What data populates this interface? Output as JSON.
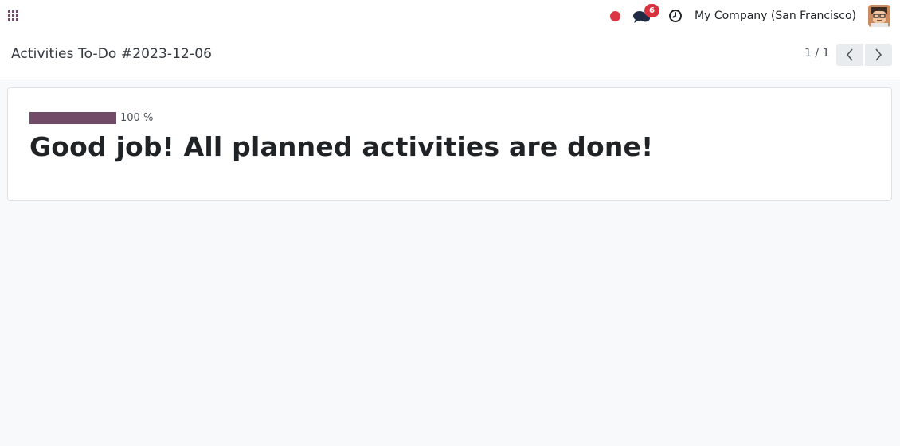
{
  "topbar": {
    "apps_icon": "grid-icon",
    "recording_indicator": "red-dot-icon",
    "messages": {
      "icon": "chat-bubbles-icon",
      "badge_count": "6"
    },
    "activities_icon": "clock-icon",
    "company_name": "My Company (San Francisco)",
    "user_avatar": "avatar"
  },
  "control_panel": {
    "title": "Activities To-Do #2023-12-06",
    "pager": {
      "value": "1 / 1",
      "prev_icon": "chevron-left-icon",
      "next_icon": "chevron-right-icon"
    }
  },
  "card": {
    "progress": {
      "fraction": 1.0,
      "label": "100 %"
    },
    "message": "Good job! All planned activities are done!"
  },
  "colors": {
    "brand": "#714b67",
    "badge": "#d9313e",
    "record": "#dc3545"
  }
}
